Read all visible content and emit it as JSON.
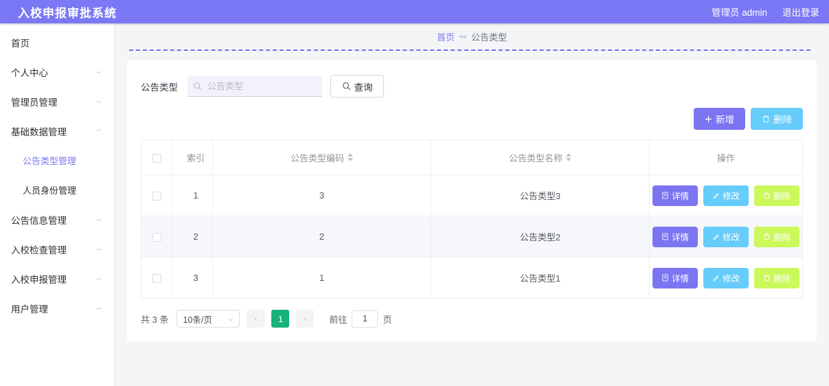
{
  "header": {
    "title": "入校申报审批系统",
    "user": "管理员 admin",
    "logout": "退出登录"
  },
  "sidebar": {
    "items": [
      {
        "label": "首页",
        "caret": "none",
        "active": false,
        "sub": false
      },
      {
        "label": "个人中心",
        "caret": "down",
        "active": false,
        "sub": false
      },
      {
        "label": "管理员管理",
        "caret": "down",
        "active": false,
        "sub": false
      },
      {
        "label": "基础数据管理",
        "caret": "up",
        "active": false,
        "sub": false
      },
      {
        "label": "公告类型管理",
        "caret": "none",
        "active": true,
        "sub": true
      },
      {
        "label": "人员身份管理",
        "caret": "none",
        "active": false,
        "sub": true
      },
      {
        "label": "公告信息管理",
        "caret": "down",
        "active": false,
        "sub": false
      },
      {
        "label": "入校检查管理",
        "caret": "down",
        "active": false,
        "sub": false
      },
      {
        "label": "入校申报管理",
        "caret": "down",
        "active": false,
        "sub": false
      },
      {
        "label": "用户管理",
        "caret": "down",
        "active": false,
        "sub": false
      }
    ]
  },
  "breadcrumb": {
    "home": "首页",
    "current": "公告类型"
  },
  "search": {
    "label": "公告类型",
    "placeholder": "公告类型",
    "value": "",
    "query_label": "查询"
  },
  "toolbar": {
    "add_label": "新增",
    "add_icon": "plus-icon",
    "delete_label": "删除",
    "delete_icon": "trash-icon"
  },
  "table": {
    "columns": [
      {
        "key": "check",
        "label": ""
      },
      {
        "key": "index",
        "label": "索引",
        "sortable": false
      },
      {
        "key": "code",
        "label": "公告类型编码",
        "sortable": true
      },
      {
        "key": "name",
        "label": "公告类型名称",
        "sortable": true
      },
      {
        "key": "ops",
        "label": "操作",
        "sortable": false
      }
    ],
    "rows": [
      {
        "index": "1",
        "code": "3",
        "name": "公告类型3"
      },
      {
        "index": "2",
        "code": "2",
        "name": "公告类型2"
      },
      {
        "index": "3",
        "code": "1",
        "name": "公告类型1"
      }
    ],
    "row_actions": {
      "detail_label": "详情",
      "edit_label": "修改",
      "delete_label": "删除"
    }
  },
  "pagination": {
    "total_text": "共 3 条",
    "page_size": "10条/页",
    "prev": "‹",
    "next": "›",
    "current_page": "1",
    "goto_label": "前往",
    "goto_value": "1",
    "page_unit": "页"
  },
  "colors": {
    "brand_purple": "#7b78f5",
    "button_purple": "#7b75f2",
    "sky": "#66ccfa",
    "lime": "#cbf85a",
    "pager_green": "#16b27a",
    "page_bg": "#f4f5f7"
  }
}
